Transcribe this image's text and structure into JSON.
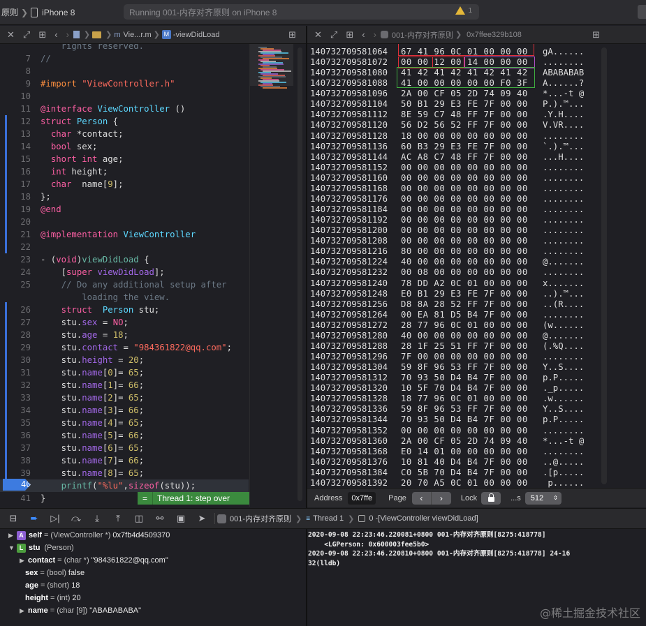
{
  "toolbar": {
    "scheme_name": "原则",
    "device": "iPhone 8",
    "status": "Running 001-内存对齐原则 on iPhone 8",
    "warning_count": "1"
  },
  "editor_header": {
    "crumb_short": "Vie...r.m",
    "crumb_method": "-viewDidLoad"
  },
  "memory_header": {
    "crumb_target": "001-内存对齐原则",
    "crumb_address": "0x7ffee329b108"
  },
  "code_lines": [
    {
      "n": "",
      "t": "rights reserved.",
      "cls": "cm",
      "indent": "    "
    },
    {
      "n": "7",
      "t": "//",
      "cls": "cm",
      "indent": ""
    },
    {
      "n": "8",
      "t": "",
      "cls": "plain",
      "indent": ""
    },
    {
      "n": "9",
      "t": "#import \"ViewController.h\"",
      "cls": "import",
      "indent": ""
    },
    {
      "n": "10",
      "t": "",
      "cls": "plain",
      "indent": ""
    },
    {
      "n": "11",
      "t": "@interface ViewController ()",
      "cls": "iface",
      "indent": ""
    },
    {
      "n": "12",
      "t": "struct Person {",
      "cls": "struct",
      "indent": ""
    },
    {
      "n": "13",
      "t": "char *contact;",
      "cls": "field",
      "indent": "  "
    },
    {
      "n": "14",
      "t": "bool sex;",
      "cls": "field",
      "indent": "  "
    },
    {
      "n": "15",
      "t": "short int age;",
      "cls": "field2",
      "indent": "  "
    },
    {
      "n": "16",
      "t": "int height;",
      "cls": "field",
      "indent": "  "
    },
    {
      "n": "17",
      "t": "char  name[9];",
      "cls": "namefield",
      "indent": "  "
    },
    {
      "n": "18",
      "t": "};",
      "cls": "plain",
      "indent": ""
    },
    {
      "n": "19",
      "t": "@end",
      "cls": "kwonly",
      "indent": ""
    },
    {
      "n": "20",
      "t": "",
      "cls": "plain",
      "indent": ""
    },
    {
      "n": "21",
      "t": "@implementation ViewController",
      "cls": "impl",
      "indent": ""
    },
    {
      "n": "22",
      "t": "",
      "cls": "plain",
      "indent": ""
    },
    {
      "n": "23",
      "t": "- (void)viewDidLoad {",
      "cls": "method",
      "indent": ""
    },
    {
      "n": "24",
      "t": "[super viewDidLoad];",
      "cls": "super",
      "indent": "    "
    },
    {
      "n": "25",
      "t": "// Do any additional setup after",
      "cls": "cm",
      "indent": "    "
    },
    {
      "n": "",
      "t": "loading the view.",
      "cls": "cm",
      "indent": "        "
    },
    {
      "n": "26",
      "t": "struct  Person stu;",
      "cls": "decl",
      "indent": "    "
    },
    {
      "n": "27",
      "t": "stu.sex = NO;",
      "cls": "assign_kw",
      "indent": "    "
    },
    {
      "n": "28",
      "t": "stu.age = 18;",
      "cls": "assign_num",
      "indent": "    "
    },
    {
      "n": "29",
      "t": "stu.contact = \"984361822@qq.com\";",
      "cls": "assign_str",
      "indent": "    "
    },
    {
      "n": "30",
      "t": "stu.height = 20;",
      "cls": "assign_num",
      "indent": "    "
    },
    {
      "n": "31",
      "t": "stu.name[0]= 65;",
      "cls": "assign_name",
      "indent": "    "
    },
    {
      "n": "32",
      "t": "stu.name[1]= 66;",
      "cls": "assign_name",
      "indent": "    "
    },
    {
      "n": "33",
      "t": "stu.name[2]= 65;",
      "cls": "assign_name",
      "indent": "    "
    },
    {
      "n": "34",
      "t": "stu.name[3]= 66;",
      "cls": "assign_name",
      "indent": "    "
    },
    {
      "n": "35",
      "t": "stu.name[4]= 65;",
      "cls": "assign_name",
      "indent": "    "
    },
    {
      "n": "36",
      "t": "stu.name[5]= 66;",
      "cls": "assign_name",
      "indent": "    "
    },
    {
      "n": "37",
      "t": "stu.name[6]= 65;",
      "cls": "assign_name",
      "indent": "    "
    },
    {
      "n": "38",
      "t": "stu.name[7]= 66;",
      "cls": "assign_name",
      "indent": "    "
    },
    {
      "n": "39",
      "t": "stu.name[8]= 65;",
      "cls": "assign_name",
      "indent": "    "
    },
    {
      "n": "40",
      "t": "printf(\"%lu\",sizeof(stu));",
      "cls": "printf",
      "indent": "    "
    },
    {
      "n": "41",
      "t": "}",
      "cls": "plain",
      "indent": ""
    }
  ],
  "step_label": "Thread 1: step over",
  "memory_rows": [
    {
      "addr": "140732709581064",
      "bytes": "67 41 96 0C 01 00 00 00",
      "ascii": "gA......"
    },
    {
      "addr": "140732709581072",
      "bytes": "00 00 12 00 14 00 00 00",
      "ascii": "........"
    },
    {
      "addr": "140732709581080",
      "bytes": "41 42 41 42 41 42 41 42",
      "ascii": "ABABABAB"
    },
    {
      "addr": "140732709581088",
      "bytes": "41 00 00 00 00 00 F0 3F",
      "ascii": "A......?"
    },
    {
      "addr": "140732709581096",
      "bytes": "2A 00 CF 05 2D 74 09 40",
      "ascii": "*...-t @"
    },
    {
      "addr": "140732709581104",
      "bytes": "50 B1 29 E3 FE 7F 00 00",
      "ascii": "P.).™..."
    },
    {
      "addr": "140732709581112",
      "bytes": "8E 59 C7 48 FF 7F 00 00",
      "ascii": ".Y.H...."
    },
    {
      "addr": "140732709581120",
      "bytes": "56 D2 56 52 FF 7F 00 00",
      "ascii": "V.VR...."
    },
    {
      "addr": "140732709581128",
      "bytes": "18 00 00 00 00 00 00 00",
      "ascii": "........"
    },
    {
      "addr": "140732709581136",
      "bytes": "60 B3 29 E3 FE 7F 00 00",
      "ascii": "`.).™..."
    },
    {
      "addr": "140732709581144",
      "bytes": "AC A8 C7 48 FF 7F 00 00",
      "ascii": "...H...."
    },
    {
      "addr": "140732709581152",
      "bytes": "00 00 00 00 00 00 00 00",
      "ascii": "........"
    },
    {
      "addr": "140732709581160",
      "bytes": "00 00 00 00 00 00 00 00",
      "ascii": "........"
    },
    {
      "addr": "140732709581168",
      "bytes": "00 00 00 00 00 00 00 00",
      "ascii": "........"
    },
    {
      "addr": "140732709581176",
      "bytes": "00 00 00 00 00 00 00 00",
      "ascii": "........"
    },
    {
      "addr": "140732709581184",
      "bytes": "00 00 00 00 00 00 00 00",
      "ascii": "........"
    },
    {
      "addr": "140732709581192",
      "bytes": "00 00 00 00 00 00 00 00",
      "ascii": "........"
    },
    {
      "addr": "140732709581200",
      "bytes": "00 00 00 00 00 00 00 00",
      "ascii": "........"
    },
    {
      "addr": "140732709581208",
      "bytes": "00 00 00 00 00 00 00 00",
      "ascii": "........"
    },
    {
      "addr": "140732709581216",
      "bytes": "80 00 00 00 00 00 00 00",
      "ascii": "........"
    },
    {
      "addr": "140732709581224",
      "bytes": "40 00 00 00 00 00 00 00",
      "ascii": "@......."
    },
    {
      "addr": "140732709581232",
      "bytes": "00 08 00 00 00 00 00 00",
      "ascii": "........"
    },
    {
      "addr": "140732709581240",
      "bytes": "78 DD A2 0C 01 00 00 00",
      "ascii": "x......."
    },
    {
      "addr": "140732709581248",
      "bytes": "E0 B1 29 E3 FE 7F 00 00",
      "ascii": "..).™..."
    },
    {
      "addr": "140732709581256",
      "bytes": "D8 8A 28 52 FF 7F 00 00",
      "ascii": "..(R...."
    },
    {
      "addr": "140732709581264",
      "bytes": "00 EA 81 D5 B4 7F 00 00",
      "ascii": "........"
    },
    {
      "addr": "140732709581272",
      "bytes": "28 77 96 0C 01 00 00 00",
      "ascii": "(w......"
    },
    {
      "addr": "140732709581280",
      "bytes": "40 00 00 00 00 00 00 00",
      "ascii": "@......."
    },
    {
      "addr": "140732709581288",
      "bytes": "28 1F 25 51 FF 7F 00 00",
      "ascii": "(.%Q...."
    },
    {
      "addr": "140732709581296",
      "bytes": "7F 00 00 00 00 00 00 00",
      "ascii": "........"
    },
    {
      "addr": "140732709581304",
      "bytes": "59 8F 96 53 FF 7F 00 00",
      "ascii": "Y..S...."
    },
    {
      "addr": "140732709581312",
      "bytes": "70 93 50 D4 B4 7F 00 00",
      "ascii": "p.P....."
    },
    {
      "addr": "140732709581320",
      "bytes": "10 5F 70 D4 B4 7F 00 00",
      "ascii": "._p....."
    },
    {
      "addr": "140732709581328",
      "bytes": "18 77 96 0C 01 00 00 00",
      "ascii": ".w......"
    },
    {
      "addr": "140732709581336",
      "bytes": "59 8F 96 53 FF 7F 00 00",
      "ascii": "Y..S...."
    },
    {
      "addr": "140732709581344",
      "bytes": "70 93 50 D4 B4 7F 00 00",
      "ascii": "p.P....."
    },
    {
      "addr": "140732709581352",
      "bytes": "00 00 00 00 00 00 00 00",
      "ascii": "........"
    },
    {
      "addr": "140732709581360",
      "bytes": "2A 00 CF 05 2D 74 09 40",
      "ascii": "*...-t @"
    },
    {
      "addr": "140732709581368",
      "bytes": "E0 14 01 00 00 00 00 00",
      "ascii": "........"
    },
    {
      "addr": "140732709581376",
      "bytes": "10 81 40 D4 B4 7F 00 00",
      "ascii": "..@....."
    },
    {
      "addr": "140732709581384",
      "bytes": "C0 5B 70 D4 B4 7F 00 00",
      "ascii": ".[p....."
    },
    {
      "addr": "140732709581392",
      "bytes": "20 70 A5 0C 01 00 00 00",
      "ascii": " p......"
    }
  ],
  "memory_footer": {
    "address_label": "Address",
    "address_value": "0x7ffe",
    "page_label": "Page",
    "lock_label": "Lock",
    "bytes_label": "...s",
    "bytes_value": "512"
  },
  "debug_bar": {
    "target": "001-内存对齐原则",
    "thread": "Thread 1",
    "frame": "0 -[ViewController viewDidLoad]"
  },
  "variables": [
    {
      "badge": "A",
      "name": "self",
      "type": "(ViewController *)",
      "value": "0x7fb4d4509370",
      "expanded": false,
      "level": 0
    },
    {
      "badge": "L",
      "name": "stu",
      "type": "(Person)",
      "value": "",
      "expanded": true,
      "level": 0
    },
    {
      "badge": "",
      "name": "contact",
      "type": "(char *)",
      "value": "\"984361822@qq.com\"",
      "expanded": false,
      "level": 1
    },
    {
      "badge": "",
      "name": "sex",
      "type": "(bool)",
      "value": "false",
      "expanded": null,
      "level": 1
    },
    {
      "badge": "",
      "name": "age",
      "type": "(short)",
      "value": "18",
      "expanded": null,
      "level": 1
    },
    {
      "badge": "",
      "name": "height",
      "type": "(int)",
      "value": "20",
      "expanded": null,
      "level": 1
    },
    {
      "badge": "",
      "name": "name",
      "type": "(char [9])",
      "value": "\"ABABABABA\"",
      "expanded": false,
      "level": 1
    }
  ],
  "console_lines": [
    "2020-09-08 22:23:46.220081+0800 001-内存对齐原则[8275:418778]",
    "    <LGPerson: 0x600003fee5b0>",
    "2020-09-08 22:23:46.220810+0800 001-内存对齐原则[8275:418778] 24-16",
    "32(lldb)"
  ],
  "watermark": "@稀土掘金技术社区",
  "colors": {
    "highlight_red": "#e0303a",
    "highlight_purple": "#b050c8",
    "highlight_green": "#3fae3f",
    "accent_blue": "#3d7be0"
  }
}
